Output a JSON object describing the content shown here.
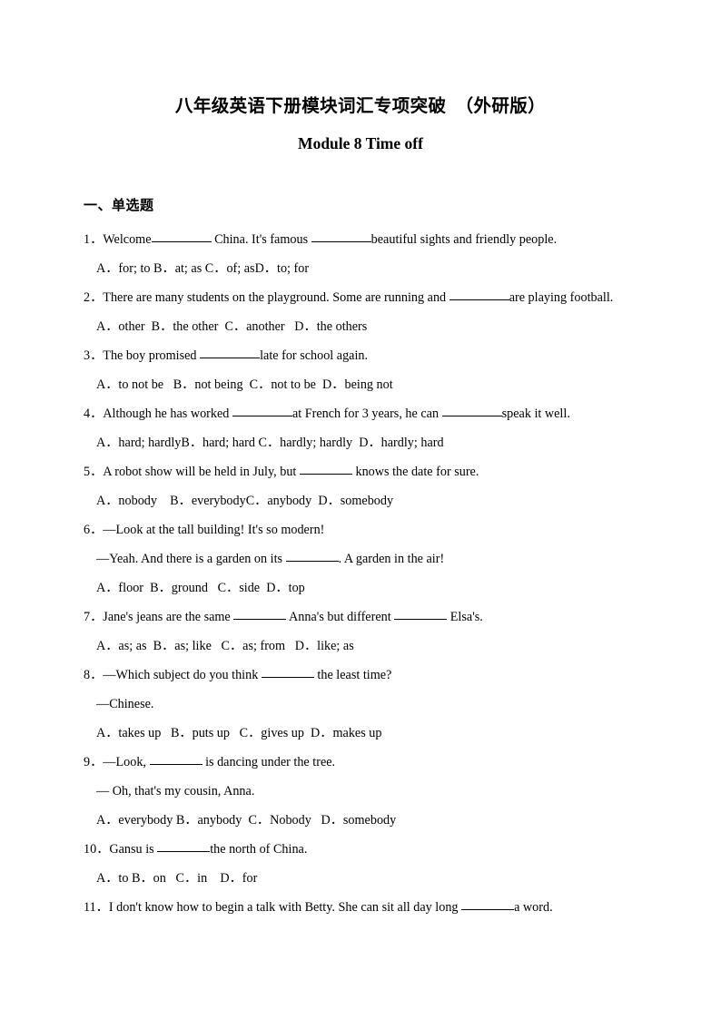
{
  "document": {
    "title": "八年级英语下册模块词汇专项突破　（外研版）",
    "subtitle": "Module 8 Time off",
    "section_heading": "一、单选题"
  },
  "questions": [
    {
      "number": "1．",
      "stem_parts": [
        "Welcome",
        "China. It's famous ",
        "beautiful sights and friendly people."
      ],
      "options_line": "A．for; to B．at; as C．of; asD．to; for",
      "extra_line": null
    },
    {
      "number": "2．",
      "stem_parts": [
        "There are many students on the playground. Some are running and ",
        "",
        "are playing football."
      ],
      "options_line": "A．other  B．the other  C．another   D．the others",
      "extra_line": null
    },
    {
      "number": "3．",
      "stem_parts": [
        "The boy promised ",
        "",
        "late for school again."
      ],
      "options_line": "A．to not be   B．not being  C．not to be  D．being not",
      "extra_line": null
    },
    {
      "number": "4．",
      "stem_parts": [
        "Although he has worked ",
        "at French for 3 years, he can ",
        "speak it well."
      ],
      "options_line": "A．hard; hardlyB．hard; hard C．hardly; hardly  D．hardly; hard",
      "extra_line": null
    },
    {
      "number": "5．",
      "stem_parts": [
        "A robot show will be held in July, but ",
        "",
        " knows the date for sure."
      ],
      "options_line": "A．nobody    B．everybodyC．anybody  D．somebody",
      "extra_line": null
    },
    {
      "number": "6．",
      "stem_parts": [
        "—Look at the tall building! It's so modern!"
      ],
      "extra_line": "—Yeah. And there is a garden on its ____. A garden in the air!",
      "options_line": "A．floor  B．ground   C．side  D．top"
    },
    {
      "number": "7．",
      "stem_parts": [
        "Jane's jeans are the same ",
        "",
        " Anna's but different ",
        " Elsa's."
      ],
      "options_line": "A．as; as  B．as; like   C．as; from   D．like; as",
      "extra_line": null
    },
    {
      "number": "8．",
      "stem_parts": [
        "—Which subject do you think ",
        "",
        " the least time?"
      ],
      "extra_line": "—Chinese.",
      "options_line": "A．takes up   B．puts up   C．gives up  D．makes up"
    },
    {
      "number": "9．",
      "stem_parts": [
        "—Look, ",
        "",
        " is dancing under the tree."
      ],
      "extra_line": "— Oh, that's my cousin, Anna.",
      "options_line": "A．everybody B．anybody  C．Nobody   D．somebody"
    },
    {
      "number": "10．",
      "stem_parts": [
        "Gansu is ",
        "",
        "the north of China."
      ],
      "options_line": "A．to B．on   C．in    D．for",
      "extra_line": null
    },
    {
      "number": "11．",
      "stem_parts": [
        "I don't know how to begin a talk with Betty. She can sit all day long ",
        "",
        "a word."
      ],
      "options_line": null,
      "extra_line": null
    }
  ],
  "lines": {
    "q1_stem_a": "Welcome",
    "q1_stem_b": " China. It's famous ",
    "q1_stem_c": "beautiful sights and friendly people.",
    "q1_opts": "A．for; to B．at; as C．of; asD．to; for",
    "q2_stem_a": "There are many students on the playground. Some are running and ",
    "q2_stem_b": "are playing football.",
    "q2_opts": "A．other  B．the other  C．another   D．the others",
    "q3_stem_a": "The boy promised ",
    "q3_stem_b": "late for school again.",
    "q3_opts": "A．to not be   B．not being  C．not to be  D．being not",
    "q4_stem_a": "Although he has worked ",
    "q4_stem_b": "at French for 3 years, he can ",
    "q4_stem_c": "speak it well.",
    "q4_opts": "A．hard; hardlyB．hard; hard C．hardly; hardly  D．hardly; hard",
    "q5_stem_a": "A robot show will be held in July, but ",
    "q5_stem_b": " knows the date for sure.",
    "q5_opts": "A．nobody    B．everybodyC．anybody  D．somebody",
    "q6_stem": "—Look at the tall building! It's so modern!",
    "q6_reply_a": "—Yeah. And there is a garden on its ",
    "q6_reply_b": ". A garden in the air!",
    "q6_opts": "A．floor  B．ground   C．side  D．top",
    "q7_stem_a": "Jane's jeans are the same ",
    "q7_stem_b": " Anna's but different ",
    "q7_stem_c": " Elsa's.",
    "q7_opts": "A．as; as  B．as; like   C．as; from   D．like; as",
    "q8_stem_a": "—Which subject do you think ",
    "q8_stem_b": " the least time?",
    "q8_reply": "—Chinese.",
    "q8_opts": "A．takes up   B．puts up   C．gives up  D．makes up",
    "q9_stem_a": "—Look, ",
    "q9_stem_b": " is dancing under the tree.",
    "q9_reply": "— Oh, that's my cousin, Anna.",
    "q9_opts": "A．everybody B．anybody  C．Nobody   D．somebody",
    "q10_stem_a": "Gansu is ",
    "q10_stem_b": "the north of China.",
    "q10_opts": "A．to B．on   C．in    D．for",
    "q11_stem_a": "I don't know how to begin a talk with Betty. She can sit all day long ",
    "q11_stem_b": "a word."
  },
  "numbers": {
    "n1": "1．",
    "n2": "2．",
    "n3": "3．",
    "n4": "4．",
    "n5": "5．",
    "n6": "6．",
    "n7": "7．",
    "n8": "8．",
    "n9": "9．",
    "n10": "10．",
    "n11": "11．"
  }
}
